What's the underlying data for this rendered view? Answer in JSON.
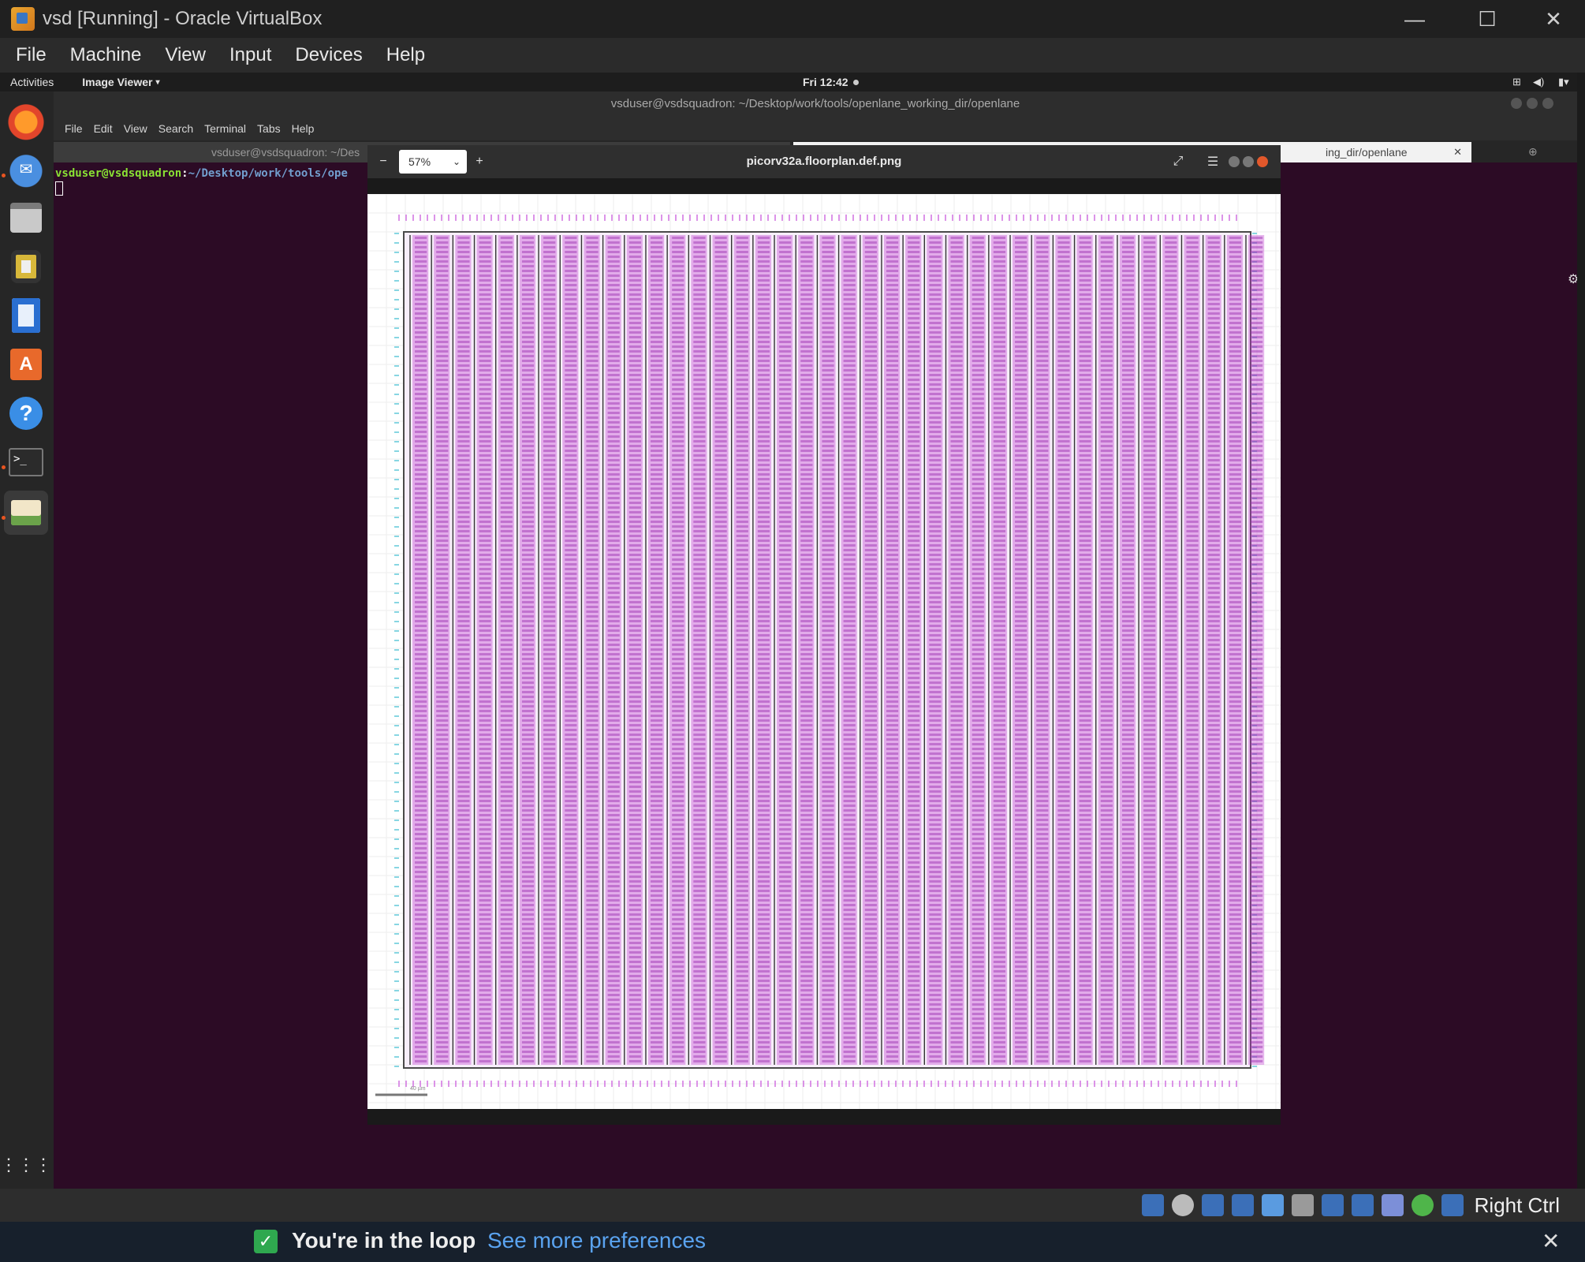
{
  "vbox": {
    "title": "vsd [Running] - Oracle VirtualBox",
    "menu": [
      "File",
      "Machine",
      "View",
      "Input",
      "Devices",
      "Help"
    ],
    "minimize": "—",
    "maximize": "☐",
    "close": "✕",
    "host_key": "Right Ctrl"
  },
  "gnome": {
    "activities": "Activities",
    "app_menu": "Image Viewer",
    "clock": "Fri 12:42",
    "dock": [
      "firefox-icon",
      "thunderbird-icon",
      "files-icon",
      "rhythmbox-icon",
      "writer-icon",
      "software-icon",
      "help-icon",
      "terminal-icon",
      "image-viewer-icon"
    ]
  },
  "terminal": {
    "title": "vsduser@vsdsquadron: ~/Desktop/work/tools/openlane_working_dir/openlane",
    "menu": [
      "File",
      "Edit",
      "View",
      "Search",
      "Terminal",
      "Tabs",
      "Help"
    ],
    "tab1": "vsduser@vsdsquadron: ~/Des",
    "tab2": "ing_dir/openlane",
    "prompt_user": "vsduser@vsdsquadron",
    "prompt_path": "~/Desktop/work/tools/ope"
  },
  "viewer": {
    "zoom": "57%",
    "filename": "picorv32a.floorplan.def.png",
    "scale_label": "40 µm"
  },
  "notification": {
    "text": "You're in the loop",
    "link": "See more preferences"
  },
  "colors": {
    "cell_magenta": "#c040d0",
    "pin_magenta": "#d070e0",
    "terminal_bg": "#2c0b25",
    "prompt_green": "#8ae234",
    "prompt_blue": "#729fcf"
  }
}
